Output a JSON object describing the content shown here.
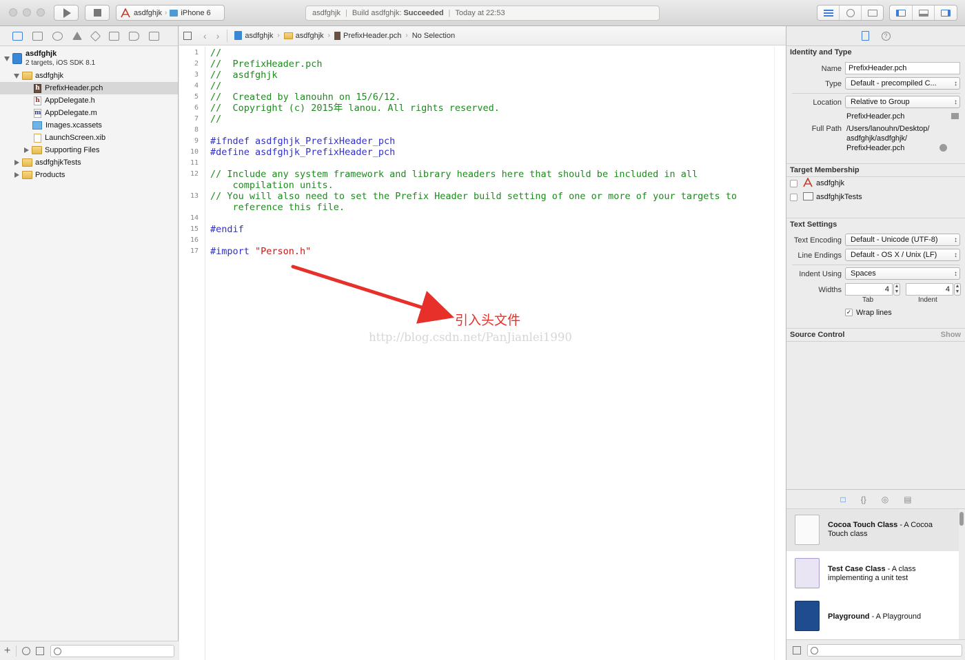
{
  "toolbar": {
    "scheme_name": "asdfghjk",
    "scheme_sep": "›",
    "device": "iPhone 6",
    "activity_project": "asdfghjk",
    "activity_build": "Build asdfghjk:",
    "activity_status": "Succeeded",
    "activity_time": "Today at 22:53",
    "accent_color": "#3c7ed9"
  },
  "navigator": {
    "project": {
      "name": "asdfghjk",
      "subtitle": "2 targets, iOS SDK 8.1"
    },
    "items": [
      {
        "label": "asdfghjk",
        "kind": "folder",
        "level": 1,
        "open": true
      },
      {
        "label": "PrefixHeader.pch",
        "kind": "pch",
        "level": 2,
        "selected": true,
        "badge": "h"
      },
      {
        "label": "AppDelegate.h",
        "kind": "h",
        "level": 2,
        "badge": "h"
      },
      {
        "label": "AppDelegate.m",
        "kind": "m",
        "level": 2,
        "badge": "m"
      },
      {
        "label": "Images.xcassets",
        "kind": "assets",
        "level": 2
      },
      {
        "label": "LaunchScreen.xib",
        "kind": "xib",
        "level": 2
      },
      {
        "label": "Supporting Files",
        "kind": "folder",
        "level": 2,
        "open": false
      },
      {
        "label": "asdfghjkTests",
        "kind": "folder",
        "level": 1,
        "open": false
      },
      {
        "label": "Products",
        "kind": "folder",
        "level": 1,
        "open": false
      }
    ]
  },
  "jumpbar": {
    "items": [
      "asdfghjk",
      "asdfghjk",
      "PrefixHeader.pch",
      "No Selection"
    ],
    "chev": "›",
    "back": "‹",
    "forward": "›"
  },
  "editor": {
    "line_numbers": [
      "1",
      "2",
      "3",
      "4",
      "5",
      "6",
      "7",
      "8",
      "9",
      "10",
      "11",
      "12",
      "13",
      "14",
      "15",
      "16",
      "17"
    ],
    "lines": [
      {
        "text": "//",
        "style": "comment"
      },
      {
        "text": "//  PrefixHeader.pch",
        "style": "comment"
      },
      {
        "text": "//  asdfghjk",
        "style": "comment"
      },
      {
        "text": "//",
        "style": "comment"
      },
      {
        "text": "//  Created by lanouhn on 15/6/12.",
        "style": "comment"
      },
      {
        "text": "//  Copyright (c) 2015年 lanou. All rights reserved.",
        "style": "comment"
      },
      {
        "text": "//",
        "style": "comment"
      },
      {
        "text": "",
        "style": "plain"
      },
      {
        "text": "#ifndef asdfghjk_PrefixHeader_pch",
        "style": "pre"
      },
      {
        "text": "#define asdfghjk_PrefixHeader_pch",
        "style": "pre"
      },
      {
        "text": "",
        "style": "plain"
      },
      {
        "text": "// Include any system framework and library headers here that should be included in all",
        "style": "comment"
      },
      {
        "text": "    compilation units.",
        "style": "comment"
      },
      {
        "text": "// You will also need to set the Prefix Header build setting of one or more of your targets to",
        "style": "comment"
      },
      {
        "text": "    reference this file.",
        "style": "comment"
      },
      {
        "text": "",
        "style": "plain"
      },
      {
        "text": "#endif",
        "style": "pre"
      },
      {
        "text": "",
        "style": "plain"
      },
      {
        "text": "#import ",
        "style": "pre",
        "string": "\"Person.h\""
      }
    ],
    "annotation": "引入头文件",
    "annotation_color": "#e8302a",
    "watermark": "http://blog.csdn.net/PanJianlei1990"
  },
  "inspector": {
    "identity": {
      "heading": "Identity and Type",
      "name_label": "Name",
      "name_value": "PrefixHeader.pch",
      "type_label": "Type",
      "type_value": "Default - precompiled C...",
      "location_label": "Location",
      "location_value": "Relative to Group",
      "location_file": "PrefixHeader.pch",
      "fullpath_label": "Full Path",
      "fullpath_lines": [
        "/Users/lanouhn/Desktop/",
        "asdfghjk/asdfghjk/",
        "PrefixHeader.pch"
      ]
    },
    "membership": {
      "heading": "Target Membership",
      "targets": [
        {
          "label": "asdfghjk",
          "checked": false
        },
        {
          "label": "asdfghjkTests",
          "checked": false
        }
      ]
    },
    "text_settings": {
      "heading": "Text Settings",
      "encoding_label": "Text Encoding",
      "encoding_value": "Default - Unicode (UTF-8)",
      "endings_label": "Line Endings",
      "endings_value": "Default - OS X / Unix (LF)",
      "indent_label": "Indent Using",
      "indent_value": "Spaces",
      "widths_label": "Widths",
      "tab_value": "4",
      "indent_width_value": "4",
      "tab_caption": "Tab",
      "indent_caption": "Indent",
      "wrap_label": "Wrap lines",
      "wrap_checked": true,
      "check_mark": "✓"
    },
    "source_control": {
      "heading": "Source Control",
      "show": "Show"
    }
  },
  "library": {
    "tabs": [
      "□",
      "{}",
      "◎",
      "▤"
    ],
    "items": [
      {
        "title": "Cocoa Touch Class",
        "desc": " - A Cocoa Touch class",
        "selected": true,
        "thumb": "cocoa"
      },
      {
        "title": "Test Case Class",
        "desc": " - A class implementing a unit test",
        "selected": false,
        "thumb": "test"
      },
      {
        "title": "Playground",
        "desc": " - A Playground",
        "selected": false,
        "thumb": "play"
      }
    ]
  }
}
